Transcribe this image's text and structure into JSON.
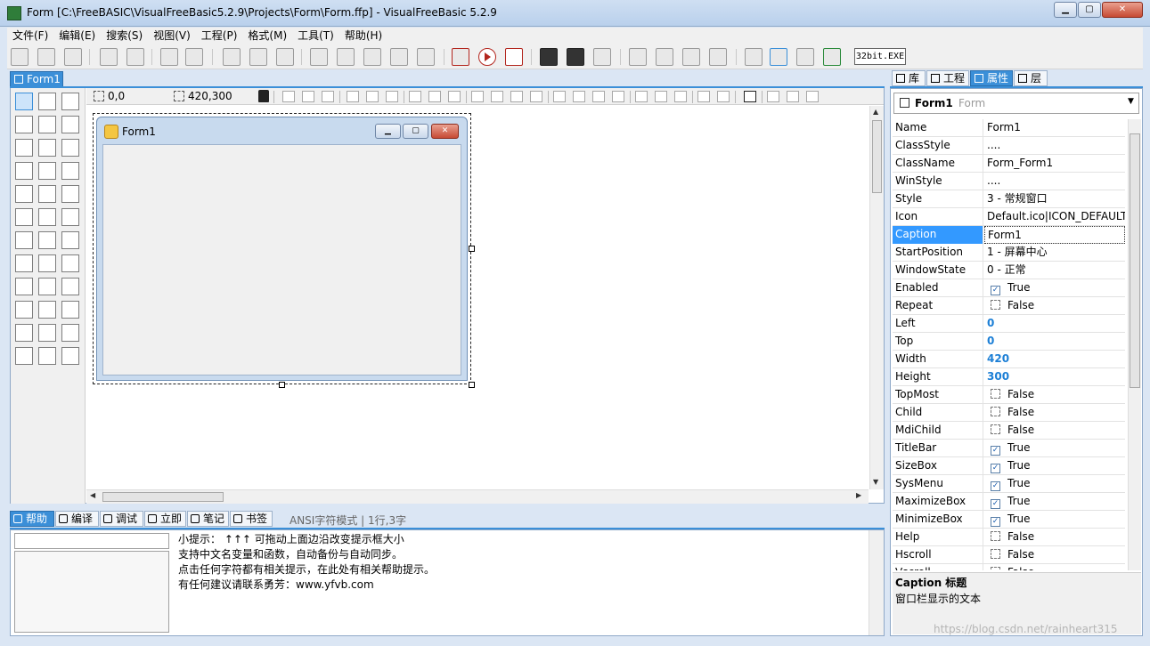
{
  "window": {
    "title": "Form [C:\\FreeBASIC\\VisualFreeBasic5.2.9\\Projects\\Form\\Form.ffp] - VisualFreeBasic 5.2.9"
  },
  "menu": [
    "文件(F)",
    "编辑(E)",
    "搜索(S)",
    "视图(V)",
    "工程(P)",
    "格式(M)",
    "工具(T)",
    "帮助(H)"
  ],
  "toolbar": {
    "bitness_label": "32bit.EXE"
  },
  "doc_tab": "Form1",
  "designer": {
    "position": "0,0",
    "size": "420,300",
    "form_caption": "Form1"
  },
  "bottom_tabs": [
    "帮助",
    "编译",
    "调试",
    "立即",
    "笔记",
    "书签"
  ],
  "status": "ANSI字符模式 | 1行,3字",
  "help_lines": [
    "小提示： ↑↑↑ 可拖动上面边沿改变提示框大小",
    "支持中文名变量和函数，自动备份与自动同步。",
    "点击任何字符都有相关提示，在此处有相关帮助提示。",
    "有任何建议请联系勇芳：www.yfvb.com"
  ],
  "right_tabs": [
    "库",
    "工程",
    "属性",
    "层"
  ],
  "object_selector": {
    "name": "Form1",
    "class": "Form"
  },
  "properties": [
    {
      "name": "Name",
      "value": "Form1",
      "kind": "text"
    },
    {
      "name": "ClassStyle",
      "value": "....",
      "kind": "text"
    },
    {
      "name": "ClassName",
      "value": "Form_Form1",
      "kind": "text"
    },
    {
      "name": "WinStyle",
      "value": "....",
      "kind": "text"
    },
    {
      "name": "Style",
      "value": "3 - 常规窗口",
      "kind": "text"
    },
    {
      "name": "Icon",
      "value": "Default.ico|ICON_DEFAULT",
      "kind": "text"
    },
    {
      "name": "Caption",
      "value": "Form1",
      "kind": "text",
      "selected": true
    },
    {
      "name": "StartPosition",
      "value": "1 - 屏幕中心",
      "kind": "text"
    },
    {
      "name": "WindowState",
      "value": "0 - 正常",
      "kind": "text"
    },
    {
      "name": "Enabled",
      "value": "True",
      "kind": "check",
      "checked": true
    },
    {
      "name": "Repeat",
      "value": "False",
      "kind": "check",
      "checked": false
    },
    {
      "name": "Left",
      "value": "0",
      "kind": "num"
    },
    {
      "name": "Top",
      "value": "0",
      "kind": "num"
    },
    {
      "name": "Width",
      "value": "420",
      "kind": "num"
    },
    {
      "name": "Height",
      "value": "300",
      "kind": "num"
    },
    {
      "name": "TopMost",
      "value": "False",
      "kind": "check",
      "checked": false
    },
    {
      "name": "Child",
      "value": "False",
      "kind": "check",
      "checked": false
    },
    {
      "name": "MdiChild",
      "value": "False",
      "kind": "check",
      "checked": false
    },
    {
      "name": "TitleBar",
      "value": "True",
      "kind": "check",
      "checked": true
    },
    {
      "name": "SizeBox",
      "value": "True",
      "kind": "check",
      "checked": true
    },
    {
      "name": "SysMenu",
      "value": "True",
      "kind": "check",
      "checked": true
    },
    {
      "name": "MaximizeBox",
      "value": "True",
      "kind": "check",
      "checked": true
    },
    {
      "name": "MinimizeBox",
      "value": "True",
      "kind": "check",
      "checked": true
    },
    {
      "name": "Help",
      "value": "False",
      "kind": "check",
      "checked": false
    },
    {
      "name": "Hscroll",
      "value": "False",
      "kind": "check",
      "checked": false
    },
    {
      "name": "Vscroll",
      "value": "False",
      "kind": "check",
      "checked": false
    }
  ],
  "property_description": {
    "title": "Caption  标题",
    "text": "窗口栏显示的文本"
  },
  "watermark": "https://blog.csdn.net/rainheart315",
  "colors": {
    "accent": "#3b8fd8",
    "selection": "#3399ff",
    "number": "#1c7fd6"
  }
}
